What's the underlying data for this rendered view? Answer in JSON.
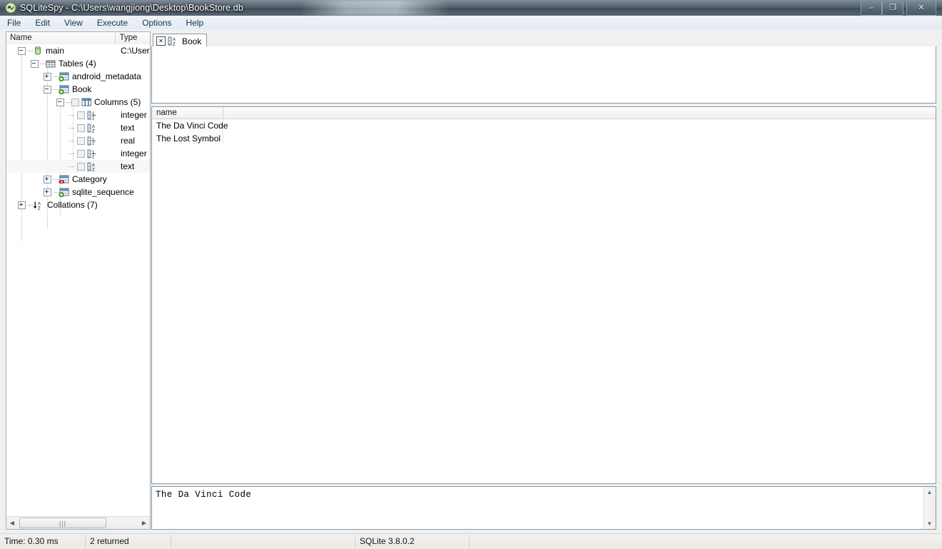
{
  "window": {
    "title": "SQLiteSpy - C:\\Users\\wangjiong\\Desktop\\BookStore.db",
    "app_icon": "sqlitespy-logo-icon",
    "controls": {
      "minimize": "–",
      "maximize": "❐",
      "close": "✕"
    }
  },
  "menu": {
    "items": [
      {
        "label": "File"
      },
      {
        "label": "Edit"
      },
      {
        "label": "View"
      },
      {
        "label": "Execute"
      },
      {
        "label": "Options"
      },
      {
        "label": "Help"
      }
    ]
  },
  "tree_panel": {
    "headers": {
      "name": "Name",
      "type": "Type"
    },
    "nodes": [
      {
        "label": "main",
        "type": "C:\\Users",
        "icon": "database-cylinder-icon",
        "indent": 0,
        "expander": "minus"
      },
      {
        "label": "Tables (4)",
        "type": "",
        "icon": "tables-grid-icon",
        "indent": 1,
        "expander": "minus"
      },
      {
        "label": "android_metadata",
        "type": "",
        "icon": "table-green-icon",
        "indent": 2,
        "expander": "plus"
      },
      {
        "label": "Book",
        "type": "",
        "icon": "table-green-icon",
        "indent": 2,
        "expander": "minus"
      },
      {
        "label": "Columns (5)",
        "type": "",
        "icon": "columns-icon",
        "indent": 3,
        "expander": "minus",
        "checkbox": true
      },
      {
        "label": "",
        "type": "integer",
        "icon": "column-number-icon",
        "indent": 4,
        "expander": "none",
        "checkbox": true
      },
      {
        "label": "",
        "type": "text",
        "icon": "column-text-icon",
        "indent": 4,
        "expander": "none",
        "checkbox": true
      },
      {
        "label": "",
        "type": "real",
        "icon": "column-number-icon",
        "indent": 4,
        "expander": "none",
        "checkbox": true
      },
      {
        "label": "",
        "type": "integer",
        "icon": "column-number-icon",
        "indent": 4,
        "expander": "none",
        "checkbox": true
      },
      {
        "label": "",
        "type": "text",
        "icon": "column-text-icon",
        "indent": 4,
        "expander": "none",
        "checkbox": true,
        "alt": true
      },
      {
        "label": "Category",
        "type": "",
        "icon": "table-red-icon",
        "indent": 2,
        "expander": "plus"
      },
      {
        "label": "sqlite_sequence",
        "type": "",
        "icon": "table-green-icon",
        "indent": 2,
        "expander": "plus"
      },
      {
        "label": "Collations (7)",
        "type": "",
        "icon": "sort-az-icon",
        "indent": 0,
        "expander": "plus"
      }
    ],
    "hscroll": {
      "left_arrow": "◀",
      "right_arrow": "▶",
      "thumb_grip": "|||"
    }
  },
  "tabs": [
    {
      "label": "Book",
      "close": "✕",
      "icon": "column-text-icon",
      "active": true
    }
  ],
  "editor": {
    "value": ""
  },
  "result_grid": {
    "columns": [
      "name"
    ],
    "rows": [
      [
        "The Da Vinci Code"
      ],
      [
        "The Lost Symbol"
      ]
    ]
  },
  "value_viewer": {
    "text": "The Da Vinci Code",
    "scroll_up": "▲",
    "scroll_down": "▼"
  },
  "status_bar": {
    "time": "Time: 0.30 ms",
    "returned": "2 returned",
    "gap": "",
    "version": "SQLite 3.8.0.2",
    "tail": ""
  },
  "colors": {
    "titlebar": "#3e4e5e",
    "accent_green": "#5ca83c",
    "accent_red": "#c0392b",
    "panel_border": "#8a96a2",
    "menu_text": "#17334d"
  }
}
